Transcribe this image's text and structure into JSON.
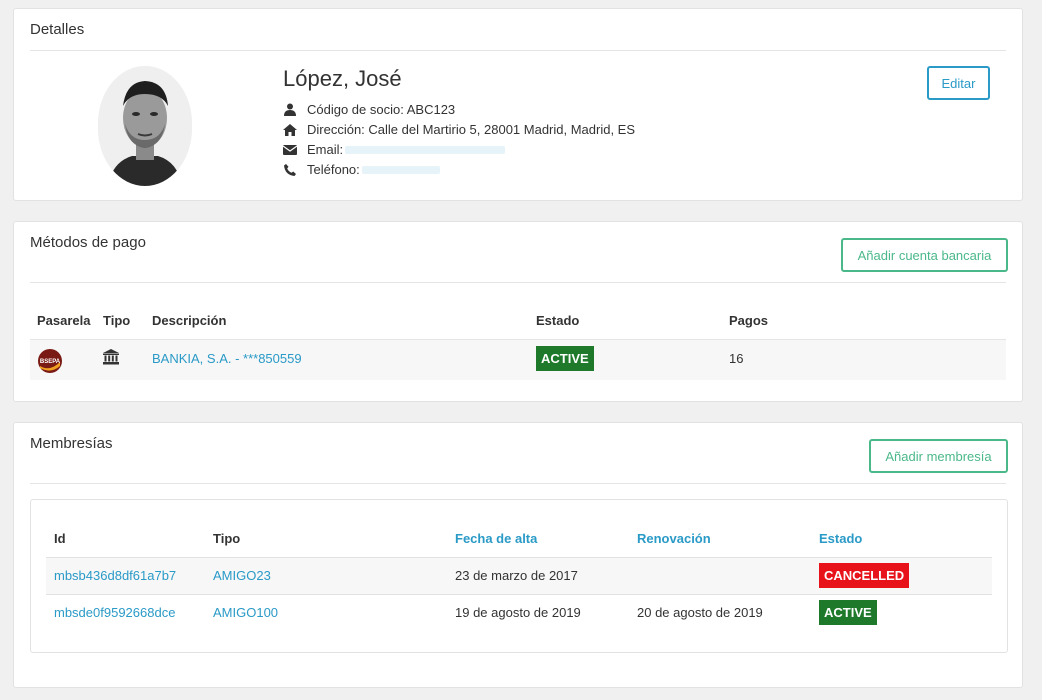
{
  "detalles": {
    "title": "Detalles",
    "name": "López, José",
    "codigo": "Código de socio: ABC123",
    "direccion": "Dirección: Calle del Martirio 5, 28001 Madrid, Madrid, ES",
    "email_label": "Email:",
    "telefono_label": "Teléfono:",
    "edit_label": "Editar"
  },
  "pagos": {
    "title": "Métodos de pago",
    "add_label": "Añadir cuenta bancaria",
    "headers": [
      "Pasarela",
      "Tipo",
      "Descripción",
      "Estado",
      "Pagos"
    ],
    "rows": [
      {
        "gateway_logo": "BSEPA",
        "tipo_icon": "bank-icon",
        "descripcion": "BANKIA, S.A. - ***850559",
        "estado": "ACTIVE",
        "pagos": "16"
      }
    ]
  },
  "membresias": {
    "title": "Membresías",
    "add_label": "Añadir membresía",
    "headers": [
      "Id",
      "Tipo",
      "Fecha de alta",
      "Renovación",
      "Estado"
    ],
    "rows": [
      {
        "id": "mbsb436d8df61a7b7",
        "tipo": "AMIGO23",
        "fecha_alta": "23 de marzo de 2017",
        "renovacion": "",
        "estado": "CANCELLED"
      },
      {
        "id": "mbsde0f9592668dce",
        "tipo": "AMIGO100",
        "fecha_alta": "19 de agosto de 2019",
        "renovacion": "20 de agosto de 2019",
        "estado": "ACTIVE"
      }
    ]
  },
  "colors": {
    "link": "#2a9ac7",
    "green_button": "#4bb88a",
    "active": "#1e7a2a",
    "cancelled": "#e8131a"
  }
}
